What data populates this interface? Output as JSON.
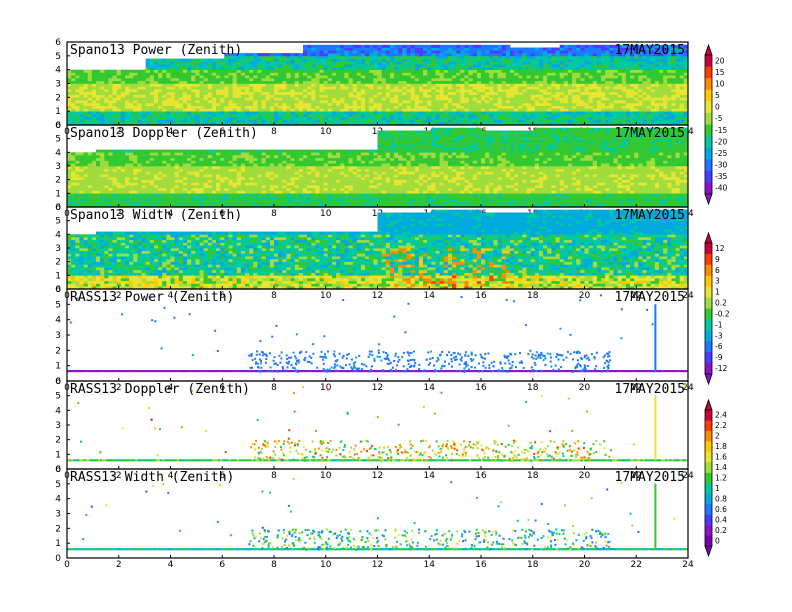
{
  "chart_data": [
    {
      "type": "heatmap",
      "title": "Spano13 Power (Zenith)",
      "date": "17MAY2015",
      "colorbar": 0,
      "x": {
        "ticks": [
          0,
          2,
          4,
          6,
          8,
          10,
          12,
          14,
          16,
          18,
          20,
          22,
          24
        ]
      },
      "y": {
        "ticks": [
          0,
          1,
          2,
          3,
          4,
          5,
          6
        ]
      },
      "pattern": "dense",
      "value_profile": [
        [
          0,
          1,
          -20
        ],
        [
          1,
          3,
          -3
        ],
        [
          3,
          4,
          -12
        ],
        [
          4,
          5,
          -20
        ],
        [
          5,
          6,
          -30
        ]
      ],
      "top_hours": [
        4.0,
        4.0,
        4.0,
        4.8,
        4.8,
        4.8,
        5.2,
        5.2,
        5.2,
        5.7,
        5.7,
        5.8,
        5.8,
        5.8,
        5.7,
        5.8,
        5.8,
        5.6,
        5.6,
        5.7,
        5.8,
        5.7,
        5.8,
        5.7,
        5.8
      ]
    },
    {
      "type": "heatmap",
      "title": "Spano13 Doppler (Zenith)",
      "date": "17MAY2015",
      "colorbar": 0,
      "x": {
        "ticks": [
          0,
          2,
          4,
          6,
          8,
          10,
          12,
          14,
          16,
          18,
          20,
          22,
          24
        ]
      },
      "y": {
        "ticks": [
          0,
          1,
          2,
          3,
          4,
          5,
          6
        ]
      },
      "pattern": "dense",
      "value_profile": [
        [
          0,
          1,
          -15
        ],
        [
          1,
          3,
          -5
        ],
        [
          3,
          4,
          -12
        ],
        [
          4,
          6,
          -15
        ]
      ],
      "top_hours": [
        4.1,
        4.3,
        4.3,
        4.3,
        4.3,
        4.2,
        4.2,
        4.2,
        4.2,
        4.2,
        4.2,
        4.2,
        5.6,
        5.6,
        5.7,
        5.8,
        5.6,
        5.6,
        5.7,
        5.8,
        5.8,
        5.7,
        5.8,
        5.7,
        5.8
      ]
    },
    {
      "type": "heatmap",
      "title": "Spano13 Width (Zenith)",
      "date": "17MAY2015",
      "colorbar": 1,
      "x": {
        "ticks": [
          0,
          2,
          4,
          6,
          8,
          10,
          12,
          14,
          16,
          18,
          20,
          22,
          24
        ]
      },
      "y": {
        "ticks": [
          0,
          1,
          2,
          3,
          4,
          5,
          6
        ]
      },
      "pattern": "dense",
      "value_profile": [
        [
          0,
          1,
          1
        ],
        [
          1,
          3,
          -1
        ],
        [
          3,
          4,
          -1
        ],
        [
          4,
          6,
          -3
        ]
      ],
      "top_hours": [
        4.1,
        4.3,
        4.3,
        4.3,
        4.3,
        4.2,
        4.2,
        4.2,
        4.2,
        4.2,
        4.2,
        4.2,
        5.6,
        5.6,
        5.7,
        5.8,
        5.6,
        5.6,
        5.7,
        5.8,
        5.8,
        5.7,
        5.8,
        5.7,
        5.8
      ]
    },
    {
      "type": "scatter",
      "title": "RASS13 Power (Zenith)",
      "date": "17MAY2015",
      "colorbar": 1,
      "x": {
        "ticks": [
          0,
          2,
          4,
          6,
          8,
          10,
          12,
          14,
          16,
          18,
          20,
          22,
          24
        ]
      },
      "y": {
        "ticks": [
          0,
          1,
          2,
          3,
          4,
          5,
          6
        ]
      },
      "pattern": "rass",
      "band_hours": [
        7,
        21
      ],
      "band_top_km": 2.0,
      "base_km": 0.65,
      "spike_hour": 22.7,
      "base_value": -12,
      "band_value": -5
    },
    {
      "type": "scatter",
      "title": "RASS13 Doppler (Zenith)",
      "date": "17MAY2015",
      "colorbar": 2,
      "x": {
        "ticks": [
          0,
          2,
          4,
          6,
          8,
          10,
          12,
          14,
          16,
          18,
          20,
          22,
          24
        ]
      },
      "y": {
        "ticks": [
          0,
          1,
          2,
          3,
          4,
          5,
          6
        ]
      },
      "pattern": "rass",
      "band_hours": [
        7,
        21
      ],
      "band_top_km": 2.0,
      "base_km": 0.6,
      "spike_hour": 22.7,
      "base_value": 1.2,
      "band_value": 1.6
    },
    {
      "type": "scatter",
      "title": "RASS13 Width (Zenith)",
      "date": "17MAY2015",
      "colorbar": 2,
      "x": {
        "ticks": [
          0,
          2,
          4,
          6,
          8,
          10,
          12,
          14,
          16,
          18,
          20,
          22,
          24
        ]
      },
      "y": {
        "ticks": [
          0,
          1,
          2,
          3,
          4,
          5,
          6
        ]
      },
      "pattern": "rass",
      "band_hours": [
        7,
        21
      ],
      "band_top_km": 2.0,
      "base_km": 0.6,
      "spike_hour": 22.7,
      "base_value": 1.0,
      "band_value": 1.1
    }
  ],
  "colorbars": [
    {
      "labels": [
        "20",
        "15",
        "10",
        "5",
        "0",
        "-5",
        "-15",
        "-20",
        "-25",
        "-30",
        "-35",
        "-40"
      ],
      "colors": [
        "#c8003c",
        "#ff3c00",
        "#ff8c00",
        "#ffc800",
        "#e6e632",
        "#a0dc3c",
        "#32c832",
        "#00c8a0",
        "#00aadc",
        "#1e78ff",
        "#4b3cff",
        "#8c14c8"
      ]
    },
    {
      "labels": [
        "12",
        "9",
        "6",
        "3",
        "1",
        "0.2",
        "-0.2",
        "-1",
        "-3",
        "-6",
        "-9",
        "-12"
      ],
      "colors": [
        "#c8003c",
        "#ff3c00",
        "#ff8c00",
        "#ffc800",
        "#e6e632",
        "#a0dc3c",
        "#32c832",
        "#00c8a0",
        "#00aadc",
        "#1e78ff",
        "#4b3cff",
        "#8c14c8"
      ]
    },
    {
      "labels": [
        "2.4",
        "2.2",
        "2",
        "1.8",
        "1.6",
        "1.4",
        "1.2",
        "1",
        "0.8",
        "0.6",
        "0.4",
        "0.2",
        "0"
      ],
      "colors": [
        "#c8003c",
        "#ff3c00",
        "#ff8c00",
        "#ffc800",
        "#e6e632",
        "#a0dc3c",
        "#32c832",
        "#00c8a0",
        "#00aadc",
        "#1e78ff",
        "#4b3cff",
        "#8c14c8",
        "#7a00b4"
      ]
    }
  ]
}
